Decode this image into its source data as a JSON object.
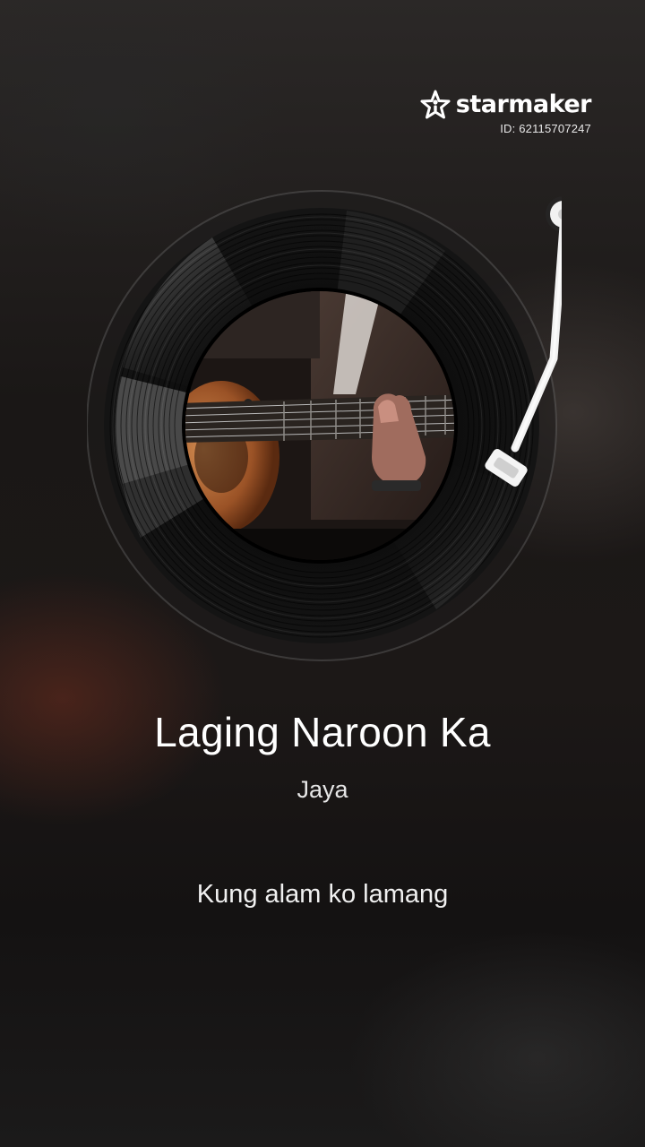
{
  "brand": {
    "name": "starmaker",
    "id_text": "ID: 62115707247"
  },
  "song": {
    "title": "Laging Naroon Ka",
    "artist": "Jaya"
  },
  "lyrics": {
    "current_line": "Kung alam ko lamang"
  },
  "icons": {
    "logo": "star-person-icon",
    "record": "vinyl-record",
    "tonearm": "tonearm",
    "cover": "guitar-cover-art"
  },
  "colors": {
    "text": "#ffffff",
    "record": "#0c0c0c",
    "tonearm": "#f2f2f2"
  }
}
